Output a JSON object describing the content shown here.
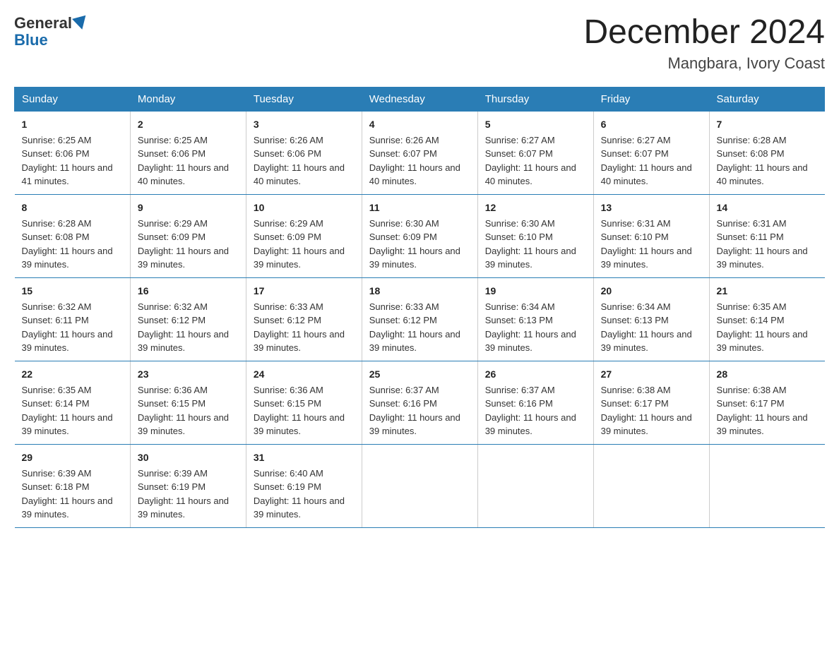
{
  "header": {
    "logo_general": "General",
    "logo_blue": "Blue",
    "title": "December 2024",
    "location": "Mangbara, Ivory Coast"
  },
  "columns": [
    "Sunday",
    "Monday",
    "Tuesday",
    "Wednesday",
    "Thursday",
    "Friday",
    "Saturday"
  ],
  "weeks": [
    [
      {
        "day": "1",
        "sunrise": "6:25 AM",
        "sunset": "6:06 PM",
        "daylight": "11 hours and 41 minutes."
      },
      {
        "day": "2",
        "sunrise": "6:25 AM",
        "sunset": "6:06 PM",
        "daylight": "11 hours and 40 minutes."
      },
      {
        "day": "3",
        "sunrise": "6:26 AM",
        "sunset": "6:06 PM",
        "daylight": "11 hours and 40 minutes."
      },
      {
        "day": "4",
        "sunrise": "6:26 AM",
        "sunset": "6:07 PM",
        "daylight": "11 hours and 40 minutes."
      },
      {
        "day": "5",
        "sunrise": "6:27 AM",
        "sunset": "6:07 PM",
        "daylight": "11 hours and 40 minutes."
      },
      {
        "day": "6",
        "sunrise": "6:27 AM",
        "sunset": "6:07 PM",
        "daylight": "11 hours and 40 minutes."
      },
      {
        "day": "7",
        "sunrise": "6:28 AM",
        "sunset": "6:08 PM",
        "daylight": "11 hours and 40 minutes."
      }
    ],
    [
      {
        "day": "8",
        "sunrise": "6:28 AM",
        "sunset": "6:08 PM",
        "daylight": "11 hours and 39 minutes."
      },
      {
        "day": "9",
        "sunrise": "6:29 AM",
        "sunset": "6:09 PM",
        "daylight": "11 hours and 39 minutes."
      },
      {
        "day": "10",
        "sunrise": "6:29 AM",
        "sunset": "6:09 PM",
        "daylight": "11 hours and 39 minutes."
      },
      {
        "day": "11",
        "sunrise": "6:30 AM",
        "sunset": "6:09 PM",
        "daylight": "11 hours and 39 minutes."
      },
      {
        "day": "12",
        "sunrise": "6:30 AM",
        "sunset": "6:10 PM",
        "daylight": "11 hours and 39 minutes."
      },
      {
        "day": "13",
        "sunrise": "6:31 AM",
        "sunset": "6:10 PM",
        "daylight": "11 hours and 39 minutes."
      },
      {
        "day": "14",
        "sunrise": "6:31 AM",
        "sunset": "6:11 PM",
        "daylight": "11 hours and 39 minutes."
      }
    ],
    [
      {
        "day": "15",
        "sunrise": "6:32 AM",
        "sunset": "6:11 PM",
        "daylight": "11 hours and 39 minutes."
      },
      {
        "day": "16",
        "sunrise": "6:32 AM",
        "sunset": "6:12 PM",
        "daylight": "11 hours and 39 minutes."
      },
      {
        "day": "17",
        "sunrise": "6:33 AM",
        "sunset": "6:12 PM",
        "daylight": "11 hours and 39 minutes."
      },
      {
        "day": "18",
        "sunrise": "6:33 AM",
        "sunset": "6:12 PM",
        "daylight": "11 hours and 39 minutes."
      },
      {
        "day": "19",
        "sunrise": "6:34 AM",
        "sunset": "6:13 PM",
        "daylight": "11 hours and 39 minutes."
      },
      {
        "day": "20",
        "sunrise": "6:34 AM",
        "sunset": "6:13 PM",
        "daylight": "11 hours and 39 minutes."
      },
      {
        "day": "21",
        "sunrise": "6:35 AM",
        "sunset": "6:14 PM",
        "daylight": "11 hours and 39 minutes."
      }
    ],
    [
      {
        "day": "22",
        "sunrise": "6:35 AM",
        "sunset": "6:14 PM",
        "daylight": "11 hours and 39 minutes."
      },
      {
        "day": "23",
        "sunrise": "6:36 AM",
        "sunset": "6:15 PM",
        "daylight": "11 hours and 39 minutes."
      },
      {
        "day": "24",
        "sunrise": "6:36 AM",
        "sunset": "6:15 PM",
        "daylight": "11 hours and 39 minutes."
      },
      {
        "day": "25",
        "sunrise": "6:37 AM",
        "sunset": "6:16 PM",
        "daylight": "11 hours and 39 minutes."
      },
      {
        "day": "26",
        "sunrise": "6:37 AM",
        "sunset": "6:16 PM",
        "daylight": "11 hours and 39 minutes."
      },
      {
        "day": "27",
        "sunrise": "6:38 AM",
        "sunset": "6:17 PM",
        "daylight": "11 hours and 39 minutes."
      },
      {
        "day": "28",
        "sunrise": "6:38 AM",
        "sunset": "6:17 PM",
        "daylight": "11 hours and 39 minutes."
      }
    ],
    [
      {
        "day": "29",
        "sunrise": "6:39 AM",
        "sunset": "6:18 PM",
        "daylight": "11 hours and 39 minutes."
      },
      {
        "day": "30",
        "sunrise": "6:39 AM",
        "sunset": "6:19 PM",
        "daylight": "11 hours and 39 minutes."
      },
      {
        "day": "31",
        "sunrise": "6:40 AM",
        "sunset": "6:19 PM",
        "daylight": "11 hours and 39 minutes."
      },
      null,
      null,
      null,
      null
    ]
  ]
}
